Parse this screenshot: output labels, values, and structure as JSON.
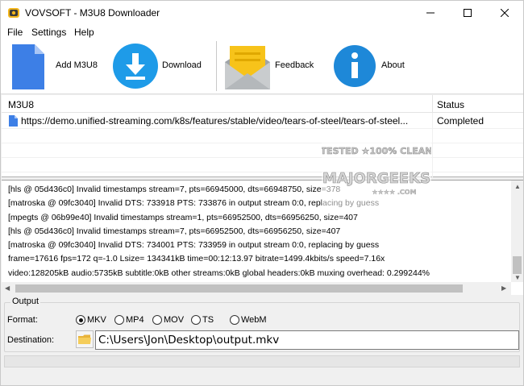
{
  "window": {
    "title": "VOVSOFT - M3U8 Downloader"
  },
  "menu": {
    "items": [
      "File",
      "Settings",
      "Help"
    ]
  },
  "toolbar": {
    "add_label": "Add M3U8",
    "download_label": "Download",
    "feedback_label": "Feedback",
    "about_label": "About"
  },
  "list": {
    "columns": [
      "M3U8",
      "Status"
    ],
    "rows": [
      {
        "url": "https://demo.unified-streaming.com/k8s/features/stable/video/tears-of-steel/tears-of-steel...",
        "status": "Completed"
      }
    ]
  },
  "watermark": {
    "line1": "TESTED ★100% CLEAN",
    "line2": "MAJORGEEKS",
    "line3": "★★★★ .COM"
  },
  "log": {
    "lines": [
      "[hls @ 05d436c0] Invalid timestamps stream=7, pts=66945000, dts=66948750, size=378",
      "[matroska @ 09fc3040] Invalid DTS: 733918 PTS: 733876 in output stream 0:0, replacing by guess",
      "[mpegts @ 06b99e40] Invalid timestamps stream=1, pts=66952500, dts=66956250, size=407",
      "[hls @ 05d436c0] Invalid timestamps stream=7, pts=66952500, dts=66956250, size=407",
      "[matroska @ 09fc3040] Invalid DTS: 734001 PTS: 733959 in output stream 0:0, replacing by guess",
      "frame=17616 fps=172 q=-1.0 Lsize=  134341kB time=00:12:13.97 bitrate=1499.4kbits/s speed=7.16x",
      "video:128205kB audio:5735kB subtitle:0kB other streams:0kB global headers:0kB muxing overhead: 0.299244%"
    ]
  },
  "output": {
    "group_title": "Output",
    "format_label": "Format:",
    "formats": [
      "MKV",
      "MP4",
      "MOV",
      "TS",
      "WebM"
    ],
    "selected_format": "MKV",
    "destination_label": "Destination:",
    "destination_value": "C:\\Users\\Jon\\Desktop\\output.mkv"
  },
  "colors": {
    "download_blue": "#1e9be8",
    "about_blue": "#1e88d8",
    "doc_blue": "#3f7fe0",
    "envelope_yellow": "#f7c31a"
  }
}
